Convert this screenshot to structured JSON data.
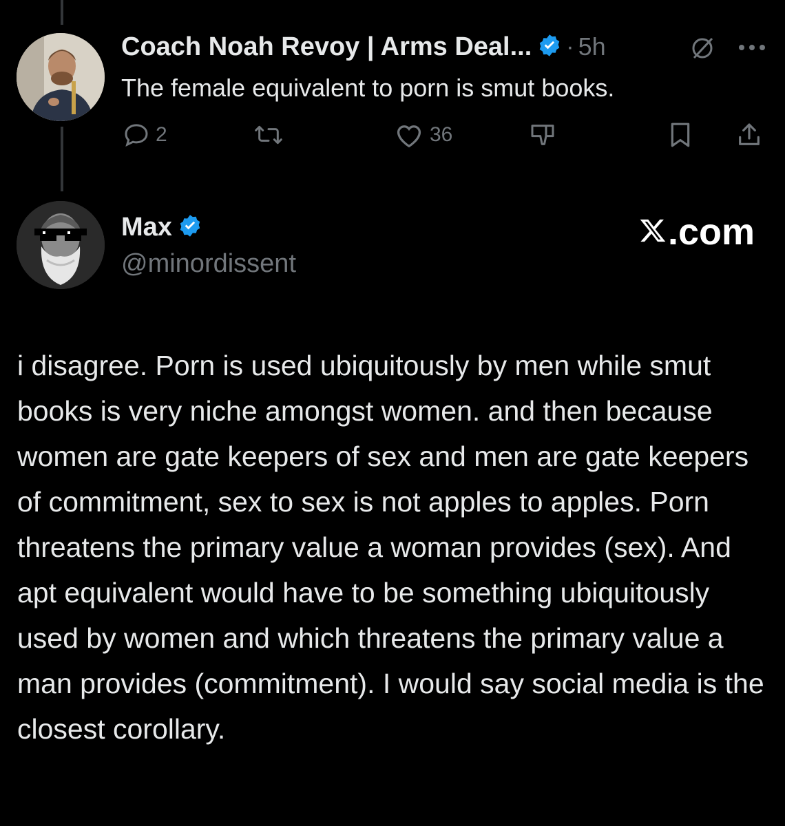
{
  "parent_tweet": {
    "author_name": "Coach Noah Revoy | Arms Deal...",
    "verified": true,
    "separator": "·",
    "time": "5h",
    "text": "The female equivalent to porn is smut books.",
    "actions": {
      "reply_count": "2",
      "retweet_count": "",
      "like_count": "36"
    }
  },
  "reply_tweet": {
    "author_name": "Max",
    "verified": true,
    "handle": "@minordissent",
    "text": "i disagree. Porn is used ubiquitously by men while smut books is very niche amongst women. and then because women are gate keepers of sex and men are gate keepers of commitment, sex to sex is not apples to apples. Porn threatens the primary value a woman provides (sex). And apt equivalent would have to be something ubiquitously used by women and which threatens the primary value a man provides (commitment). I would say social media is the closest corollary."
  },
  "watermark": {
    "suffix": ".com"
  },
  "colors": {
    "background": "#000000",
    "text": "#e7e9ea",
    "muted": "#71767b",
    "verified": "#1d9bf0",
    "thread_line": "#333639"
  }
}
